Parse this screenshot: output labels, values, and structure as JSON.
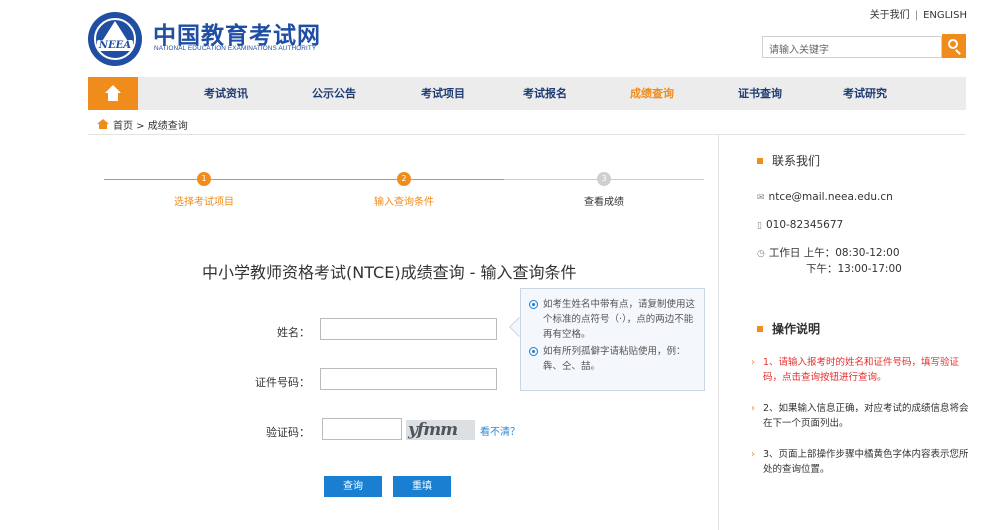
{
  "header": {
    "logo_badge": "NEEA",
    "logo_cn": "中国教育考试网",
    "logo_en": "NATIONAL EDUCATION EXAMINATIONS AUTHORITY",
    "about": "关于我们",
    "separator": "|",
    "english": "ENGLISH",
    "search_placeholder": "请输入关键字"
  },
  "nav": {
    "items": [
      "考试资讯",
      "公示公告",
      "考试项目",
      "考试报名",
      "成绩查询",
      "证书查询",
      "考试研究"
    ],
    "active": "成绩查询"
  },
  "breadcrumb": {
    "text": "首页 > 成绩查询"
  },
  "steps": [
    {
      "num": "1",
      "label": "选择考试项目",
      "state": "done"
    },
    {
      "num": "2",
      "label": "输入查询条件",
      "state": "current"
    },
    {
      "num": "3",
      "label": "查看成绩",
      "state": "pending"
    }
  ],
  "main": {
    "title": "中小学教师资格考试(NTCE)成绩查询 - 输入查询条件",
    "name_label": "姓名：",
    "id_label": "证件号码：",
    "captcha_label": "验证码：",
    "captcha_text": "yfmm",
    "refresh_text": "看不清？",
    "submit_label": "查询",
    "reset_label": "重填"
  },
  "tip": {
    "line1": "如考生姓名中带有点，请复制使用这个标准的点符号（·），点的两边不能再有空格。",
    "line2": "如有所列孤僻字请粘贴使用，例：犇、仝、喆。"
  },
  "sidebar": {
    "contact_title": "联系我们",
    "email": "ntce@mail.neea.edu.cn",
    "phone": "010-82345677",
    "hours_line1": "工作日 上午：08:30-12:00",
    "hours_line2": "下午：13:00-17:00",
    "ops_title": "操作说明",
    "ops": [
      "1、请输入报考时的姓名和证件号码，填写验证码，点击查询按钮进行查询。",
      "2、如果输入信息正确，对应考试的成绩信息将会在下一个页面列出。",
      "3、页面上部操作步骤中橘黄色字体内容表示您所处的查询位置。"
    ]
  },
  "colors": {
    "brand_blue": "#1f4ea3",
    "accent_orange": "#f08c1b",
    "button_blue": "#1a7fd0",
    "alert_red": "#e62e2e"
  }
}
